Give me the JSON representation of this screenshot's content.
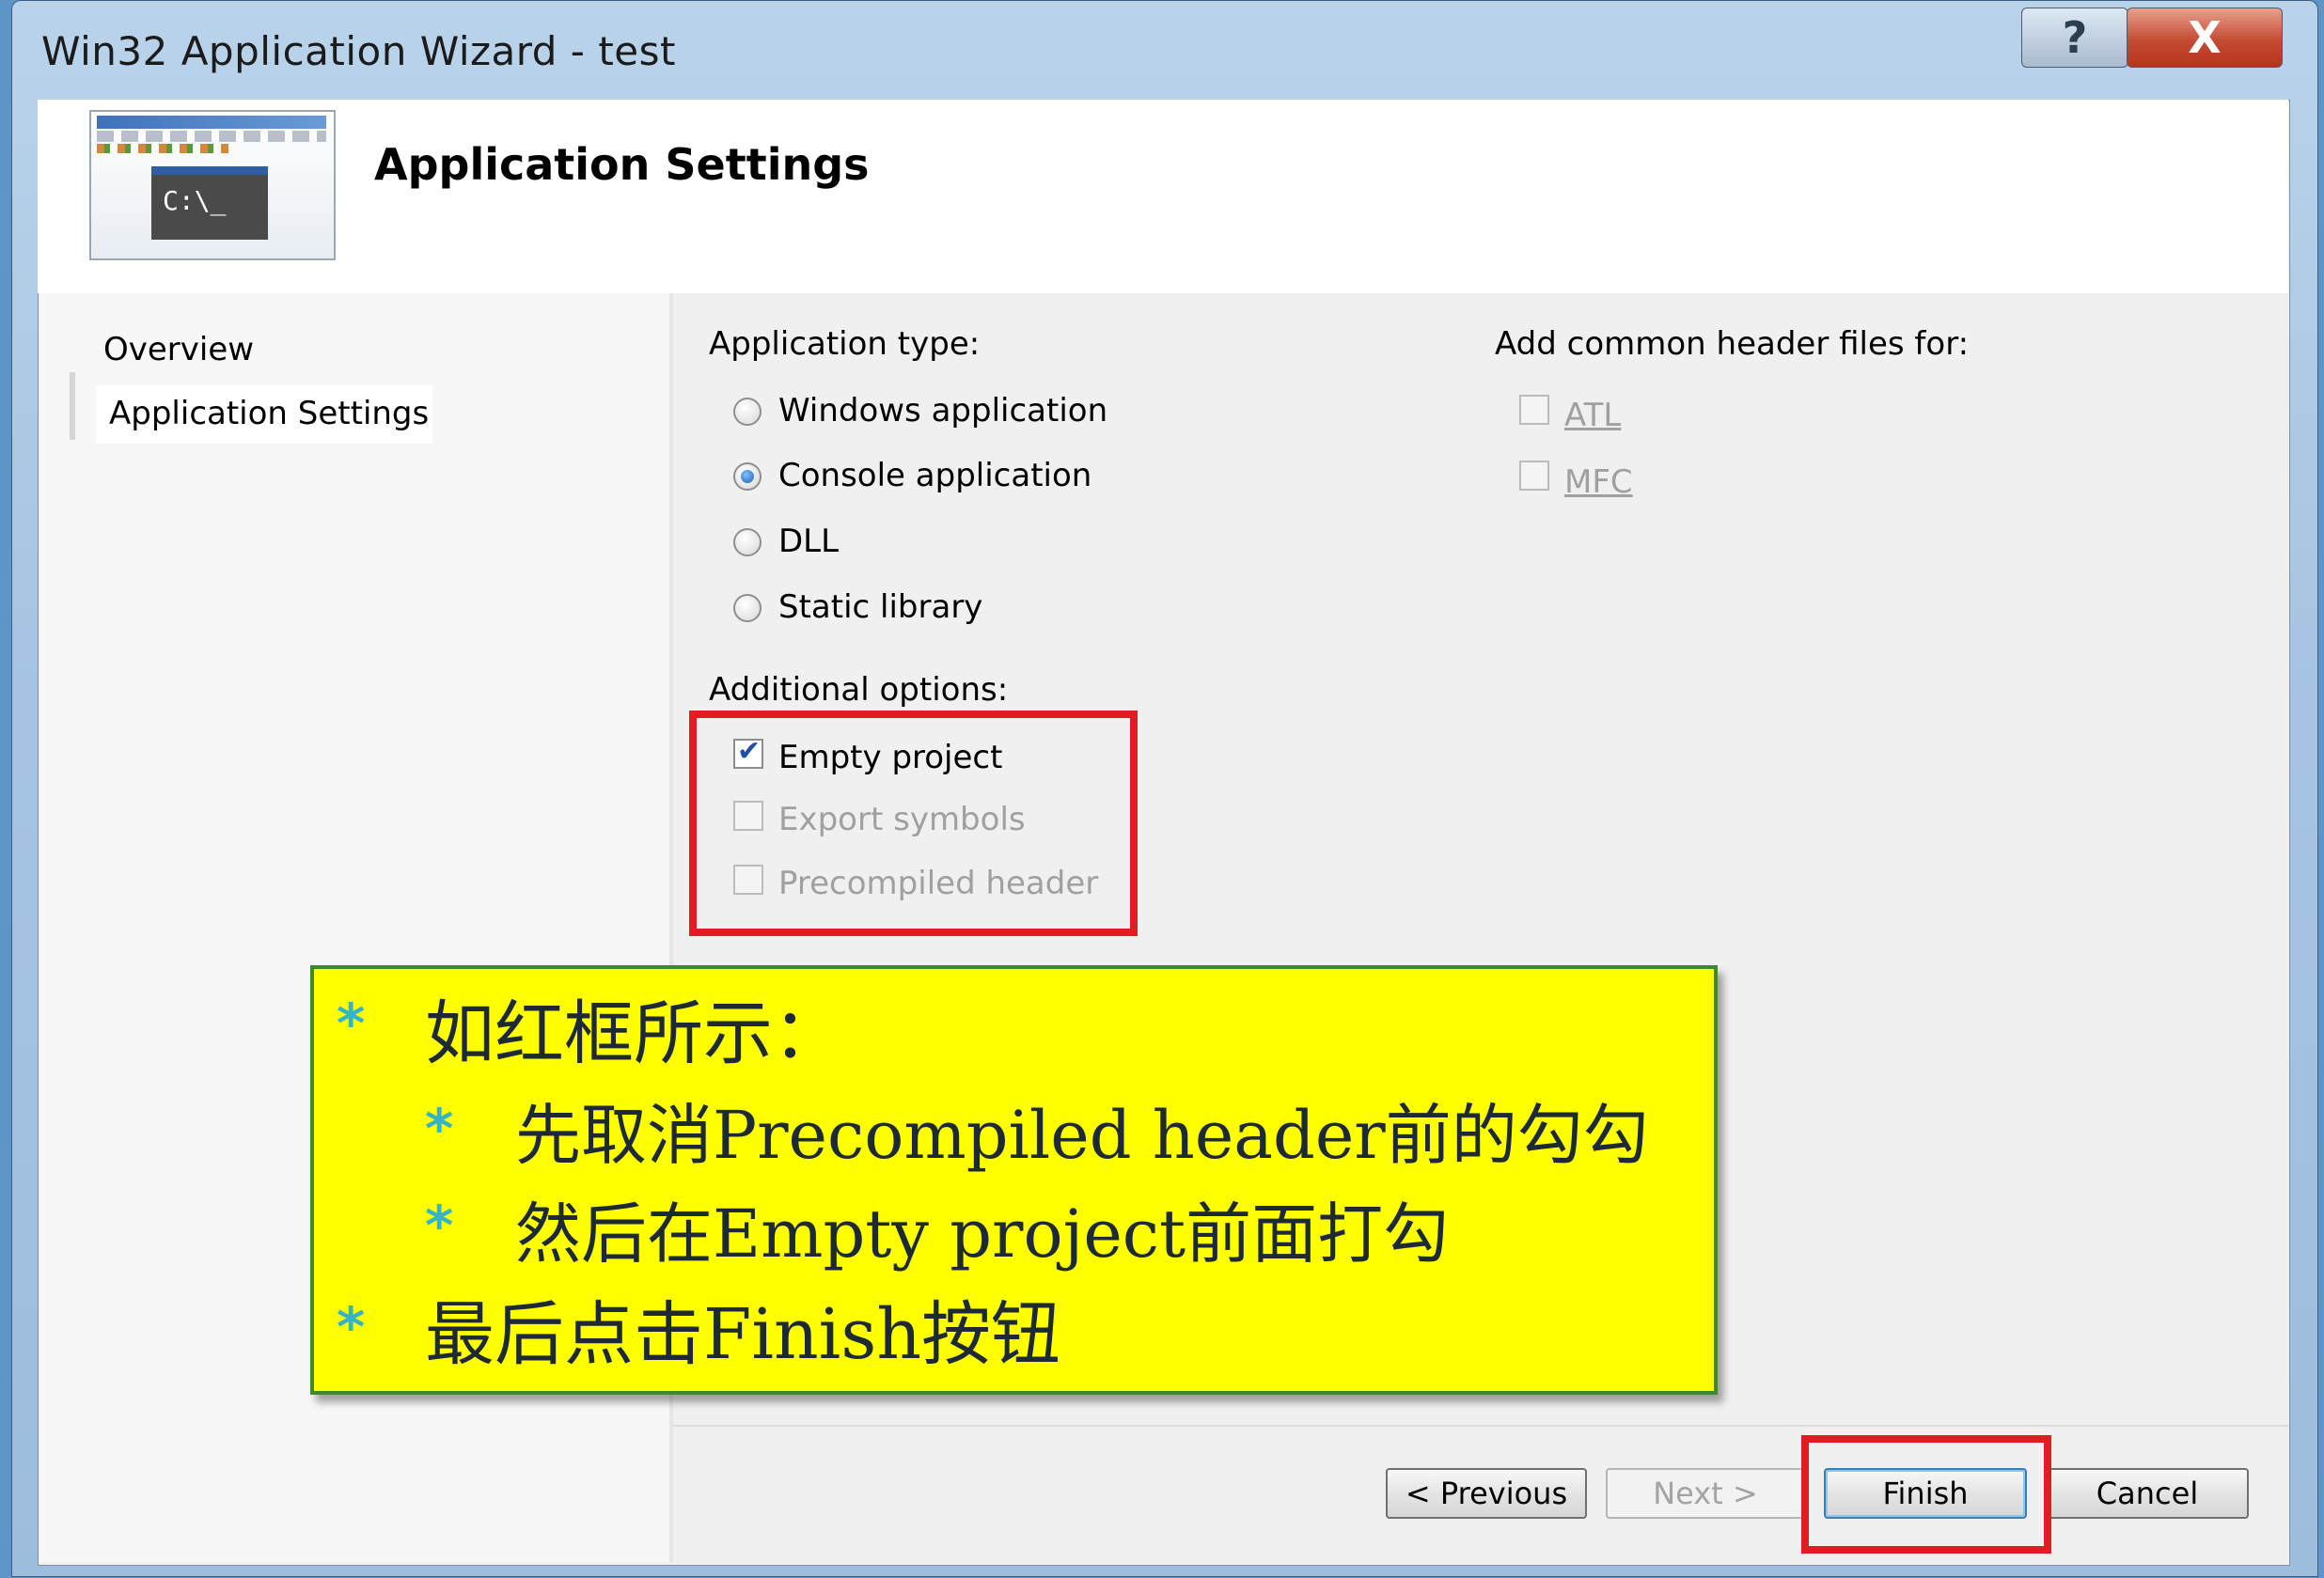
{
  "window": {
    "title": "Win32 Application Wizard - test",
    "help_glyph": "?",
    "close_glyph": "X"
  },
  "header": {
    "title": "Application Settings",
    "icon_text": "C:\\_"
  },
  "nav": {
    "items": [
      {
        "label": "Overview"
      },
      {
        "label": "Application Settings"
      }
    ]
  },
  "app_type": {
    "label": "Application type:",
    "options": [
      {
        "label": "Windows application",
        "selected": false
      },
      {
        "label": "Console application",
        "selected": true
      },
      {
        "label": "DLL",
        "selected": false
      },
      {
        "label": "Static library",
        "selected": false
      }
    ]
  },
  "headers": {
    "label": "Add common header files for:",
    "options": [
      {
        "label": "ATL",
        "checked": false,
        "enabled": false
      },
      {
        "label": "MFC",
        "checked": false,
        "enabled": false
      }
    ]
  },
  "additional": {
    "label": "Additional options:",
    "options": [
      {
        "label": "Empty project",
        "checked": true,
        "enabled": true
      },
      {
        "label": "Export symbols",
        "checked": false,
        "enabled": false
      },
      {
        "label": "Precompiled header",
        "checked": false,
        "enabled": false
      }
    ]
  },
  "annotation": {
    "bullet": "*",
    "lines": [
      "如红框所示：",
      "先取消Precompiled header前的勾勾",
      "然后在Empty project前面打勾",
      "最后点击Finish按钮"
    ]
  },
  "buttons": {
    "previous": "< Previous",
    "next": "Next >",
    "finish": "Finish",
    "cancel": "Cancel"
  },
  "colors": {
    "highlight_box": "#e31b23",
    "annotation_bg": "#ffff00",
    "annotation_border": "#3e8a2b",
    "bullet": "#35b4c6"
  }
}
